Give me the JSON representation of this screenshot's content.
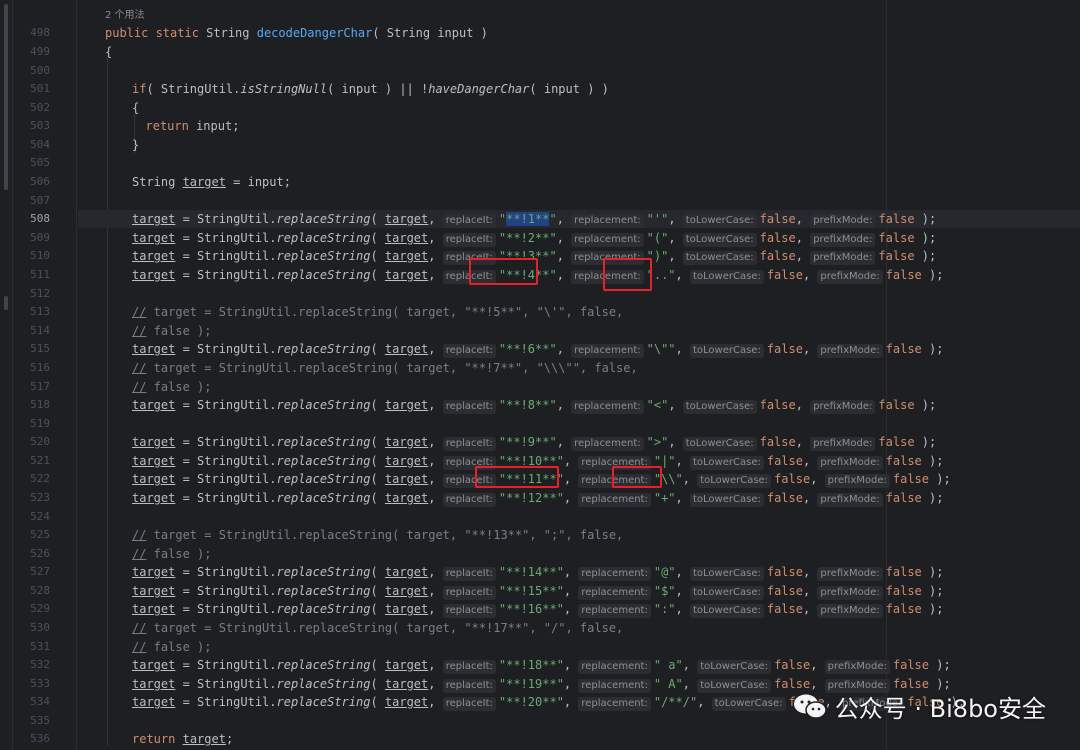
{
  "usage_hint": "2 个用法",
  "hint_labels": {
    "replace_it": "replaceIt:",
    "replacement": "replacement:",
    "to_lower": "toLowerCase:",
    "prefix": "prefixMode:"
  },
  "lines": [
    {
      "n": "498",
      "text": "public static String decodeDangerChar( String input )"
    },
    {
      "n": "499",
      "text": "{"
    },
    {
      "n": "500",
      "text": ""
    },
    {
      "n": "501",
      "text": "if( StringUtil.isStringNull( input ) || !haveDangerChar( input ) )"
    },
    {
      "n": "502",
      "text": "{"
    },
    {
      "n": "503",
      "text": "return input;"
    },
    {
      "n": "504",
      "text": "}"
    },
    {
      "n": "505",
      "text": ""
    },
    {
      "n": "506",
      "text": "String target = input;"
    },
    {
      "n": "507",
      "text": ""
    },
    {
      "n": "508",
      "text": "target = StringUtil.replaceString( target, \"**!1**\", \"'\", false, false );"
    },
    {
      "n": "509",
      "text": "target = StringUtil.replaceString( target, \"**!2**\", \"(\", false, false );"
    },
    {
      "n": "510",
      "text": "target = StringUtil.replaceString( target, \"**!3**\", \")\", false, false );"
    },
    {
      "n": "511",
      "text": "target = StringUtil.replaceString( target, \"**!4**\", \"..\", false, false );"
    },
    {
      "n": "512",
      "text": ""
    },
    {
      "n": "513",
      "text": "// target = StringUtil.replaceString( target, \"**!5**\", \"\\'\", false,"
    },
    {
      "n": "514",
      "text": "// false );"
    },
    {
      "n": "515",
      "text": "target = StringUtil.replaceString( target, \"**!6**\", \"\\\"\", false, false );"
    },
    {
      "n": "516",
      "text": "// target = StringUtil.replaceString( target, \"**!7**\", \"\\\\\\\"\", false,"
    },
    {
      "n": "517",
      "text": "// false );"
    },
    {
      "n": "518",
      "text": "target = StringUtil.replaceString( target, \"**!8**\", \"<\", false, false );"
    },
    {
      "n": "519",
      "text": ""
    },
    {
      "n": "520",
      "text": "target = StringUtil.replaceString( target, \"**!9**\", \">\", false, false );"
    },
    {
      "n": "521",
      "text": "target = StringUtil.replaceString( target, \"**!10**\", \"|\", false, false );"
    },
    {
      "n": "522",
      "text": "target = StringUtil.replaceString( target, \"**!11**\", \"\\\\\", false, false );"
    },
    {
      "n": "523",
      "text": "target = StringUtil.replaceString( target, \"**!12**\", \"+\", false, false );"
    },
    {
      "n": "524",
      "text": ""
    },
    {
      "n": "525",
      "text": "// target = StringUtil.replaceString( target, \"**!13**\", \";\", false,"
    },
    {
      "n": "526",
      "text": "// false );"
    },
    {
      "n": "527",
      "text": "target = StringUtil.replaceString( target, \"**!14**\", \"@\", false, false );"
    },
    {
      "n": "528",
      "text": "target = StringUtil.replaceString( target, \"**!15**\", \"$\", false, false );"
    },
    {
      "n": "529",
      "text": "target = StringUtil.replaceString( target, \"**!16**\", \":\", false, false );"
    },
    {
      "n": "530",
      "text": "// target = StringUtil.replaceString( target, \"**!17**\", \"/\", false,"
    },
    {
      "n": "531",
      "text": "// false );"
    },
    {
      "n": "532",
      "text": "target = StringUtil.replaceString( target, \"**!18**\", \" a\", false, false );"
    },
    {
      "n": "533",
      "text": "target = StringUtil.replaceString( target, \"**!19**\", \" A\", false, false );"
    },
    {
      "n": "534",
      "text": "target = StringUtil.replaceString( target, \"**!20**\", \"/**/\", false, false );"
    },
    {
      "n": "535",
      "text": ""
    },
    {
      "n": "536",
      "text": "return target;"
    }
  ],
  "current_line": "508",
  "watermark": "公众号 · Bi8bo安全",
  "colors": {
    "keyword": "#cf8e6d",
    "function": "#56a8f5",
    "string": "#6aab73",
    "comment": "#7a7e85",
    "highlight_box": "#e8202a"
  }
}
